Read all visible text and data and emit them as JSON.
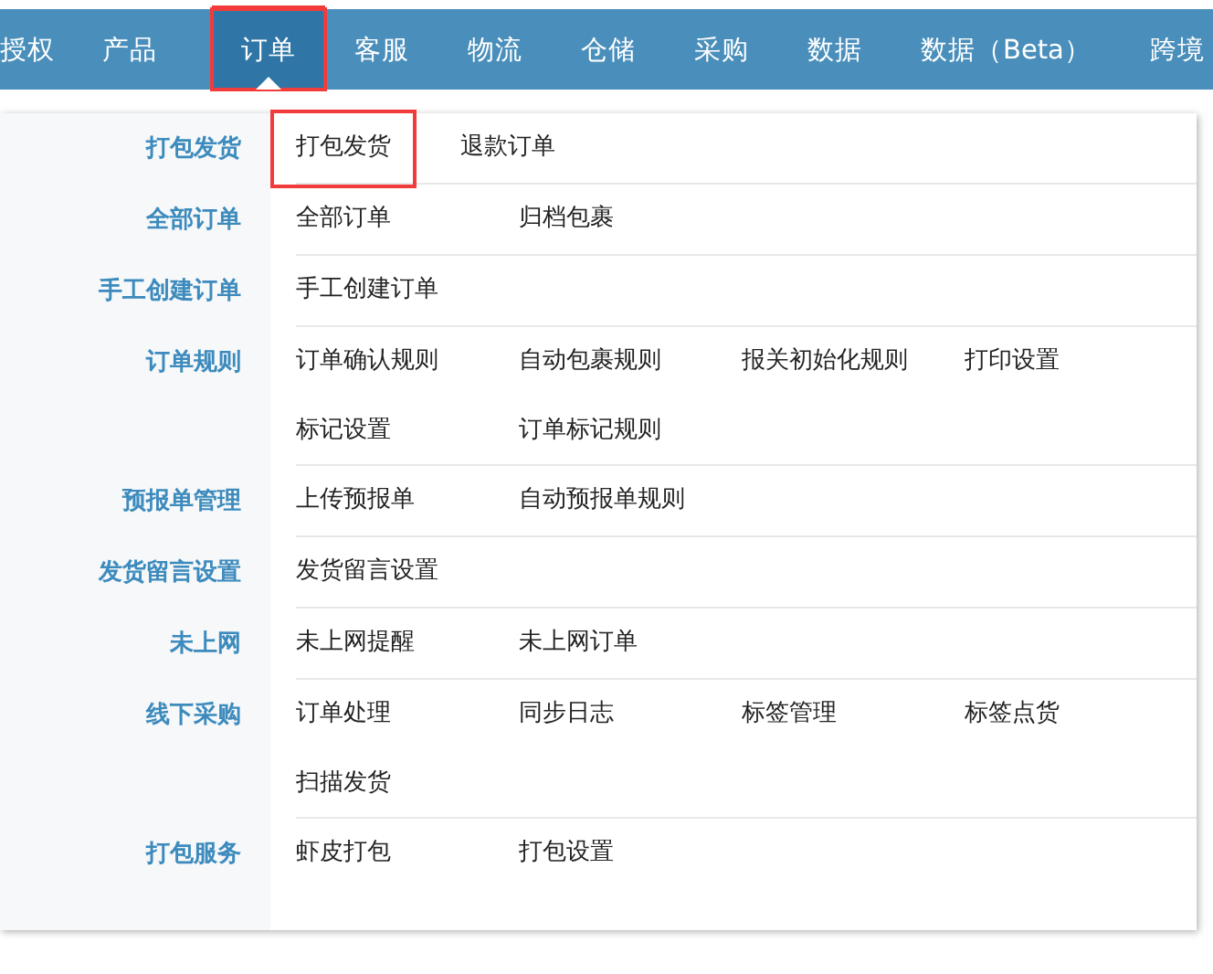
{
  "nav": [
    {
      "label": "授权",
      "selected": false,
      "highlighted": false
    },
    {
      "label": "产品",
      "selected": false,
      "highlighted": false
    },
    {
      "label": "订单",
      "selected": true,
      "highlighted": true
    },
    {
      "label": "客服",
      "selected": false,
      "highlighted": false
    },
    {
      "label": "物流",
      "selected": false,
      "highlighted": false
    },
    {
      "label": "仓储",
      "selected": false,
      "highlighted": false
    },
    {
      "label": "采购",
      "selected": false,
      "highlighted": false
    },
    {
      "label": "数据",
      "selected": false,
      "highlighted": false
    },
    {
      "label": "数据（Beta）",
      "selected": false,
      "highlighted": false
    },
    {
      "label": "跨境",
      "selected": false,
      "highlighted": false
    }
  ],
  "menu": [
    {
      "label": "打包发货",
      "links": [
        {
          "label": "打包发货",
          "highlighted": true
        },
        {
          "label": "退款订单",
          "highlighted": false
        }
      ]
    },
    {
      "label": "全部订单",
      "links": [
        {
          "label": "全部订单",
          "highlighted": false
        },
        {
          "label": "归档包裹",
          "highlighted": false
        }
      ]
    },
    {
      "label": "手工创建订单",
      "links": [
        {
          "label": "手工创建订单",
          "highlighted": false
        }
      ]
    },
    {
      "label": "订单规则",
      "links": [
        {
          "label": "订单确认规则",
          "highlighted": false
        },
        {
          "label": "自动包裹规则",
          "highlighted": false
        },
        {
          "label": "报关初始化规则",
          "highlighted": false
        },
        {
          "label": "打印设置",
          "highlighted": false
        },
        {
          "label": "标记设置",
          "highlighted": false
        },
        {
          "label": "订单标记规则",
          "highlighted": false
        }
      ]
    },
    {
      "label": "预报单管理",
      "links": [
        {
          "label": "上传预报单",
          "highlighted": false
        },
        {
          "label": "自动预报单规则",
          "highlighted": false
        }
      ]
    },
    {
      "label": "发货留言设置",
      "links": [
        {
          "label": "发货留言设置",
          "highlighted": false
        }
      ]
    },
    {
      "label": "未上网",
      "links": [
        {
          "label": "未上网提醒",
          "highlighted": false
        },
        {
          "label": "未上网订单",
          "highlighted": false
        }
      ]
    },
    {
      "label": "线下采购",
      "links": [
        {
          "label": "订单处理",
          "highlighted": false
        },
        {
          "label": "同步日志",
          "highlighted": false
        },
        {
          "label": "标签管理",
          "highlighted": false
        },
        {
          "label": "标签点货",
          "highlighted": false
        },
        {
          "label": "扫描发货",
          "highlighted": false
        }
      ]
    },
    {
      "label": "打包服务",
      "links": [
        {
          "label": "虾皮打包",
          "highlighted": false
        },
        {
          "label": "打包设置",
          "highlighted": false
        }
      ]
    }
  ]
}
